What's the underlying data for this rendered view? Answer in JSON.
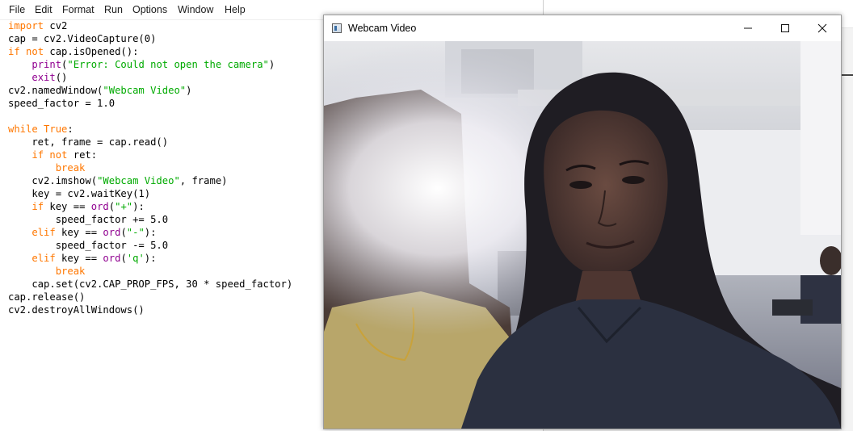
{
  "menu": [
    "File",
    "Edit",
    "Format",
    "Run",
    "Options",
    "Window",
    "Help"
  ],
  "code_lines": [
    [
      {
        "t": "import",
        "c": "kw"
      },
      {
        "t": " cv2",
        "c": ""
      }
    ],
    [
      {
        "t": "cap = cv2.VideoCapture(0)",
        "c": ""
      }
    ],
    [
      {
        "t": "if",
        "c": "kw"
      },
      {
        "t": " ",
        "c": ""
      },
      {
        "t": "not",
        "c": "kw"
      },
      {
        "t": " cap.isOpened():",
        "c": ""
      }
    ],
    [
      {
        "t": "    ",
        "c": ""
      },
      {
        "t": "print",
        "c": "bi"
      },
      {
        "t": "(",
        "c": ""
      },
      {
        "t": "\"Error: Could not open the camera\"",
        "c": "st"
      },
      {
        "t": ")",
        "c": ""
      }
    ],
    [
      {
        "t": "    ",
        "c": ""
      },
      {
        "t": "exit",
        "c": "bi"
      },
      {
        "t": "()",
        "c": ""
      }
    ],
    [
      {
        "t": "cv2.namedWindow(",
        "c": ""
      },
      {
        "t": "\"Webcam Video\"",
        "c": "st"
      },
      {
        "t": ")",
        "c": ""
      }
    ],
    [
      {
        "t": "speed_factor = 1.0",
        "c": ""
      }
    ],
    [
      {
        "t": "",
        "c": ""
      }
    ],
    [
      {
        "t": "while",
        "c": "kw"
      },
      {
        "t": " ",
        "c": ""
      },
      {
        "t": "True",
        "c": "kw"
      },
      {
        "t": ":",
        "c": ""
      }
    ],
    [
      {
        "t": "    ret, frame = cap.read()",
        "c": ""
      }
    ],
    [
      {
        "t": "    ",
        "c": ""
      },
      {
        "t": "if",
        "c": "kw"
      },
      {
        "t": " ",
        "c": ""
      },
      {
        "t": "not",
        "c": "kw"
      },
      {
        "t": " ret:",
        "c": ""
      }
    ],
    [
      {
        "t": "        ",
        "c": ""
      },
      {
        "t": "break",
        "c": "kw"
      }
    ],
    [
      {
        "t": "    cv2.imshow(",
        "c": ""
      },
      {
        "t": "\"Webcam Video\"",
        "c": "st"
      },
      {
        "t": ", frame)",
        "c": ""
      }
    ],
    [
      {
        "t": "    key = cv2.waitKey(1)",
        "c": ""
      }
    ],
    [
      {
        "t": "    ",
        "c": ""
      },
      {
        "t": "if",
        "c": "kw"
      },
      {
        "t": " key == ",
        "c": ""
      },
      {
        "t": "ord",
        "c": "bi"
      },
      {
        "t": "(",
        "c": ""
      },
      {
        "t": "\"+\"",
        "c": "st"
      },
      {
        "t": "):",
        "c": ""
      }
    ],
    [
      {
        "t": "        speed_factor += 5.0",
        "c": ""
      }
    ],
    [
      {
        "t": "    ",
        "c": ""
      },
      {
        "t": "elif",
        "c": "kw"
      },
      {
        "t": " key == ",
        "c": ""
      },
      {
        "t": "ord",
        "c": "bi"
      },
      {
        "t": "(",
        "c": ""
      },
      {
        "t": "\"-\"",
        "c": "st"
      },
      {
        "t": "):",
        "c": ""
      }
    ],
    [
      {
        "t": "        speed_factor -= 5.0",
        "c": ""
      }
    ],
    [
      {
        "t": "    ",
        "c": ""
      },
      {
        "t": "elif",
        "c": "kw"
      },
      {
        "t": " key == ",
        "c": ""
      },
      {
        "t": "ord",
        "c": "bi"
      },
      {
        "t": "(",
        "c": ""
      },
      {
        "t": "'q'",
        "c": "st"
      },
      {
        "t": "):",
        "c": ""
      }
    ],
    [
      {
        "t": "        ",
        "c": ""
      },
      {
        "t": "break",
        "c": "kw"
      }
    ],
    [
      {
        "t": "    cap.set(cv2.CAP_PROP_FPS, 30 * speed_factor)",
        "c": ""
      }
    ],
    [
      {
        "t": "cap.release()",
        "c": ""
      }
    ],
    [
      {
        "t": "cv2.destroyAllWindows()",
        "c": ""
      }
    ]
  ],
  "webcam_window": {
    "title": "Webcam Video",
    "icon": "window-app-icon",
    "controls": [
      "minimize",
      "maximize",
      "close"
    ]
  },
  "colors": {
    "keyword": "#ff7700",
    "builtin": "#900090",
    "string": "#00aa00"
  }
}
